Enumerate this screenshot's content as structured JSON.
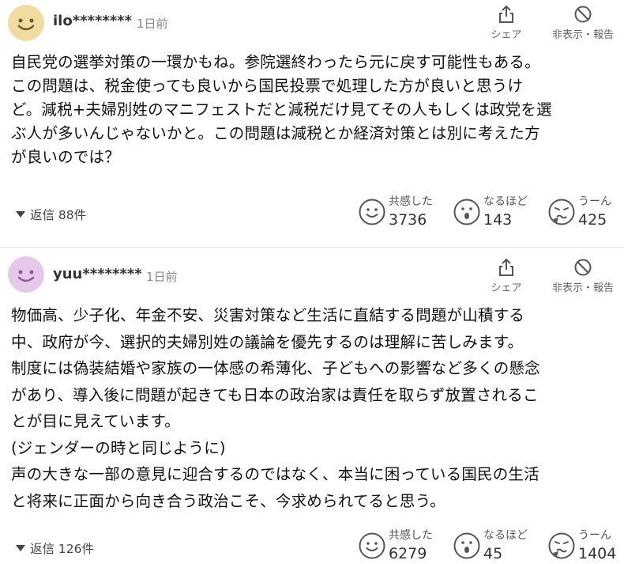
{
  "comments": [
    {
      "username": "ilo********",
      "time": "1日前",
      "avatar_color": "#f0dca0",
      "share_label": "シェア",
      "hide_report_label": "非表示・報告",
      "body": "自民党の選挙対策の一環かもね。参院選終わったら元に戻す可能性もある。\nこの問題は、税金使っても良いから国民投票で処理した方が良いと思うけ\nど。減税+夫婦別姓のマニフェストだと減税だけ見てその人もしくは政党を選\nぶ人が多いんじゃないかと。この問題は減税とか経済対策とは別に考えた方\nが良いのでは？",
      "replies_label": "返信 88件",
      "reactions": [
        {
          "label": "共感した",
          "count": "3736",
          "icon": "smile-face-icon"
        },
        {
          "label": "なるほど",
          "count": "143",
          "icon": "surprised-face-icon"
        },
        {
          "label": "うーん",
          "count": "425",
          "icon": "troubled-face-icon"
        }
      ]
    },
    {
      "username": "yuu********",
      "time": "1日前",
      "avatar_color": "#e6c8ec",
      "share_label": "シェア",
      "hide_report_label": "非表示・報告",
      "body": "物価高、少子化、年金不安、災害対策など生活に直結する問題が山積する\n中、政府が今、選択的夫婦別姓の議論を優先するのは理解に苦しみます。\n制度には偽装結婚や家族の一体感の希薄化、子どもへの影響など多くの懸念\nがあり、導入後に問題が起きても日本の政治家は責任を取らず放置されるこ\nとが目に見えています。\n(ジェンダーの時と同じように)\n声の大きな一部の意見に迎合するのではなく、本当に困っている国民の生活\nと将来に正面から向き合う政治こそ、今求められてると思う。",
      "replies_label": "返信 126件",
      "reactions": [
        {
          "label": "共感した",
          "count": "6279",
          "icon": "smile-face-icon"
        },
        {
          "label": "なるほど",
          "count": "45",
          "icon": "surprised-face-icon"
        },
        {
          "label": "うーん",
          "count": "1404",
          "icon": "troubled-face-icon"
        }
      ]
    }
  ]
}
